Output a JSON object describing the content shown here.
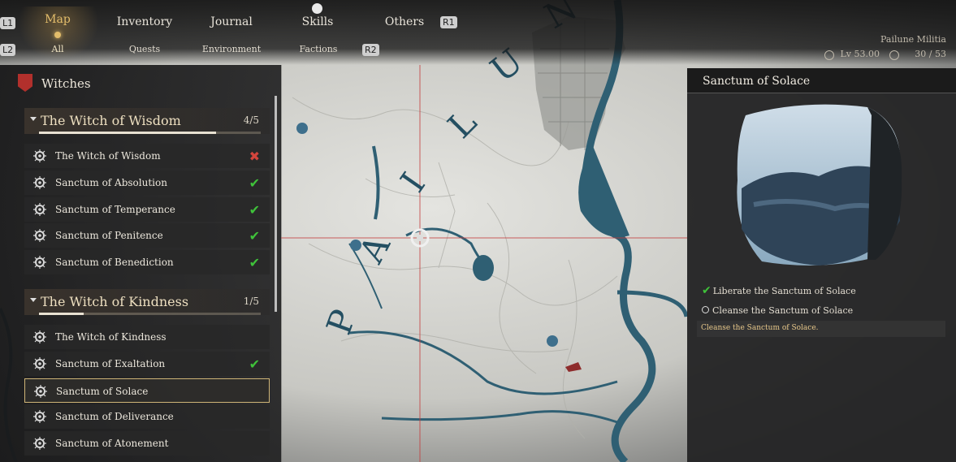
{
  "top_tabs": {
    "l1": "L1",
    "r1": "R1",
    "l2": "L2",
    "r2": "R2",
    "items": [
      "Map",
      "Inventory",
      "Journal",
      "Skills",
      "Others"
    ],
    "active": "Map"
  },
  "sub_tabs": {
    "items": [
      "All",
      "Quests",
      "Environment",
      "Factions"
    ],
    "active": "All"
  },
  "player": {
    "faction": "Pailune Militia",
    "level": "Lv 53.00",
    "progress": "30 / 53"
  },
  "map": {
    "region_label": "P A I L U N"
  },
  "panel": {
    "title": "Witches",
    "groups": [
      {
        "title": "The Witch of Wisdom",
        "count": "4/5",
        "progress": 0.8,
        "items": [
          {
            "label": "The Witch of Wisdom",
            "status": "cross"
          },
          {
            "label": "Sanctum of Absolution",
            "status": "check"
          },
          {
            "label": "Sanctum of Temperance",
            "status": "check"
          },
          {
            "label": "Sanctum of Penitence",
            "status": "check"
          },
          {
            "label": "Sanctum of Benediction",
            "status": "check"
          }
        ]
      },
      {
        "title": "The Witch of Kindness",
        "count": "1/5",
        "progress": 0.2,
        "items": [
          {
            "label": "The Witch of Kindness",
            "status": "none"
          },
          {
            "label": "Sanctum of Exaltation",
            "status": "check"
          },
          {
            "label": "Sanctum of Solace",
            "status": "none",
            "selected": true
          },
          {
            "label": "Sanctum of Deliverance",
            "status": "none"
          },
          {
            "label": "Sanctum of Atonement",
            "status": "none"
          }
        ]
      }
    ]
  },
  "detail": {
    "title": "Sanctum of Solace",
    "objectives": [
      {
        "label": "Liberate the Sanctum of Solace",
        "done": true
      },
      {
        "label": "Cleanse the Sanctum of Solace",
        "done": false
      }
    ],
    "description": "Cleanse the Sanctum of Solace."
  },
  "colors": {
    "accent": "#e3bd6b",
    "check": "#3fc23a",
    "cross": "#d2453c",
    "water": "#2f5f73",
    "paper": "#c9c9c4"
  }
}
